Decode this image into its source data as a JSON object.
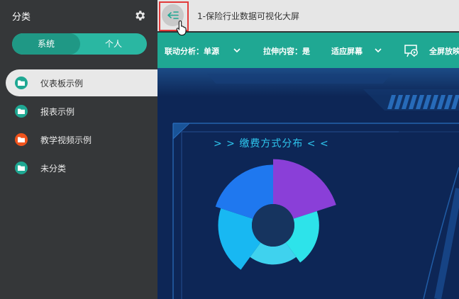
{
  "sidebar": {
    "title": "分类",
    "tabs": [
      {
        "label": "系统",
        "active": true
      },
      {
        "label": "个人",
        "active": false
      }
    ],
    "items": [
      {
        "label": "仪表板示例",
        "color": "#1fa893",
        "active": true
      },
      {
        "label": "报表示例",
        "color": "#1fa893",
        "active": false
      },
      {
        "label": "教学视频示例",
        "color": "#f0531c",
        "active": false
      },
      {
        "label": "未分类",
        "color": "#1fa893",
        "active": false
      }
    ]
  },
  "topbar": {
    "title": "1-保险行业数据可视化大屏"
  },
  "toolbar": {
    "linkage": "联动分析：单源",
    "stretch": "拉伸内容：是",
    "fit": "适应屏幕",
    "fullscreen": "全屏放映"
  },
  "dashboard": {
    "panel_title": "> > 缴费方式分布 < <"
  },
  "colors": {
    "accent": "#1fa893",
    "sidebar_bg": "#353739",
    "canvas_bg": "#0d2656",
    "highlight_box": "#e23a3a"
  },
  "chart_data": {
    "type": "pie",
    "variant": "rose",
    "title": "> > 缴费方式分布 < <",
    "slices": [
      {
        "value": 40,
        "color": "#8a3fd8"
      },
      {
        "value": 22,
        "color": "#2de3ea"
      },
      {
        "value": 16,
        "color": "#3fd2ee"
      },
      {
        "value": 30,
        "color": "#18b8f2"
      },
      {
        "value": 35,
        "color": "#1f78ef"
      }
    ]
  }
}
